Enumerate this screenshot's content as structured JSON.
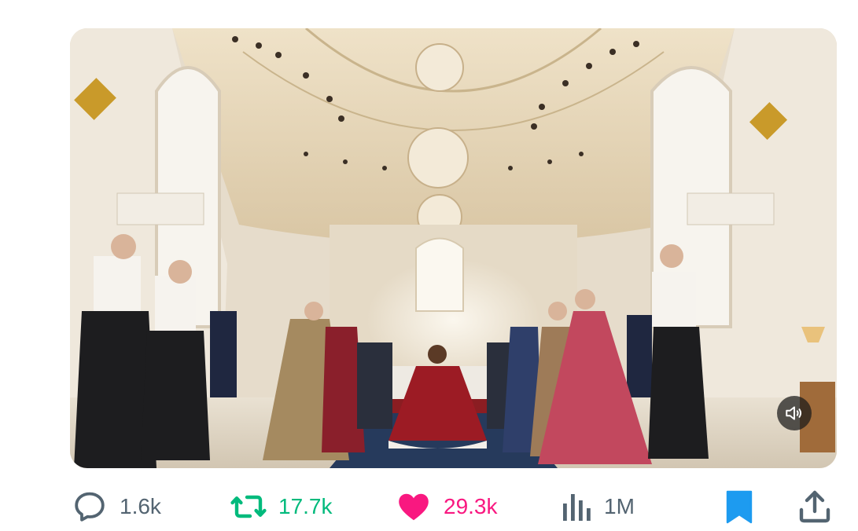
{
  "tweet": {
    "top_link_text": "",
    "media": {
      "kind": "video",
      "mute_icon": "speaker-muted-icon"
    },
    "actions": {
      "reply": {
        "icon": "reply-bubble-icon",
        "count": "1.6k",
        "color": "#536471"
      },
      "retweet": {
        "icon": "retweet-icon",
        "count": "17.7k",
        "color": "#00ba7c"
      },
      "like": {
        "icon": "heart-filled-icon",
        "count": "29.3k",
        "color": "#f91880"
      },
      "views": {
        "icon": "bar-chart-icon",
        "count": "1M",
        "color": "#536471"
      },
      "bookmark": {
        "icon": "bookmark-filled-icon",
        "color": "#1d9bf0"
      },
      "share": {
        "icon": "share-upload-icon",
        "color": "#536471"
      }
    }
  }
}
